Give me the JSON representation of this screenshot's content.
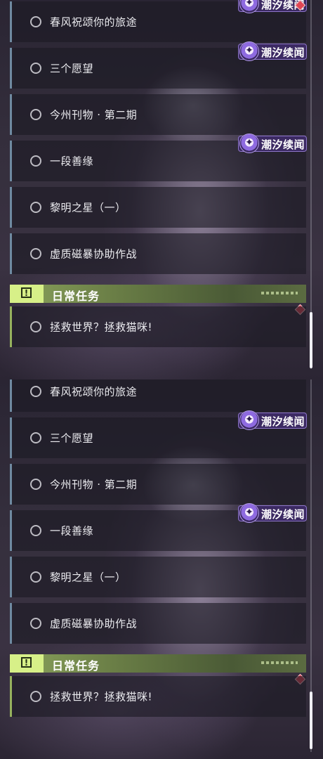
{
  "panels": [
    {
      "quests": [
        {
          "title": "春风祝颂你的旅途"
        },
        {
          "title": "三个愿望"
        },
        {
          "title": "今州刊物 · 第二期"
        },
        {
          "title": "一段善缘"
        },
        {
          "title": "黎明之星（一）"
        },
        {
          "title": "虚质磁暴协助作战"
        }
      ],
      "badges": [
        "潮汐续闻",
        "潮汐续闻",
        "潮汐续闻"
      ],
      "daily_header": {
        "title": "日常任务",
        "icon": "exclamation-box-icon"
      },
      "daily_quests": [
        {
          "title": "拯救世界？拯救猫咪!"
        }
      ]
    },
    {
      "quests": [
        {
          "title": "春风祝颂你的旅途"
        },
        {
          "title": "三个愿望"
        },
        {
          "title": "今州刊物 · 第二期"
        },
        {
          "title": "一段善缘"
        },
        {
          "title": "黎明之星（一）"
        },
        {
          "title": "虚质磁暴协助作战"
        }
      ],
      "badges": [
        "潮汐续闻",
        "潮汐续闻"
      ],
      "daily_header": {
        "title": "日常任务",
        "icon": "exclamation-box-icon"
      },
      "daily_quests": [
        {
          "title": "拯救世界？拯救猫咪!"
        }
      ]
    }
  ],
  "colors": {
    "quest_accent": "#6f8aa1",
    "daily_accent": "#d7f088",
    "badge_bg": "#3c2a63",
    "marker": "#e04654"
  }
}
